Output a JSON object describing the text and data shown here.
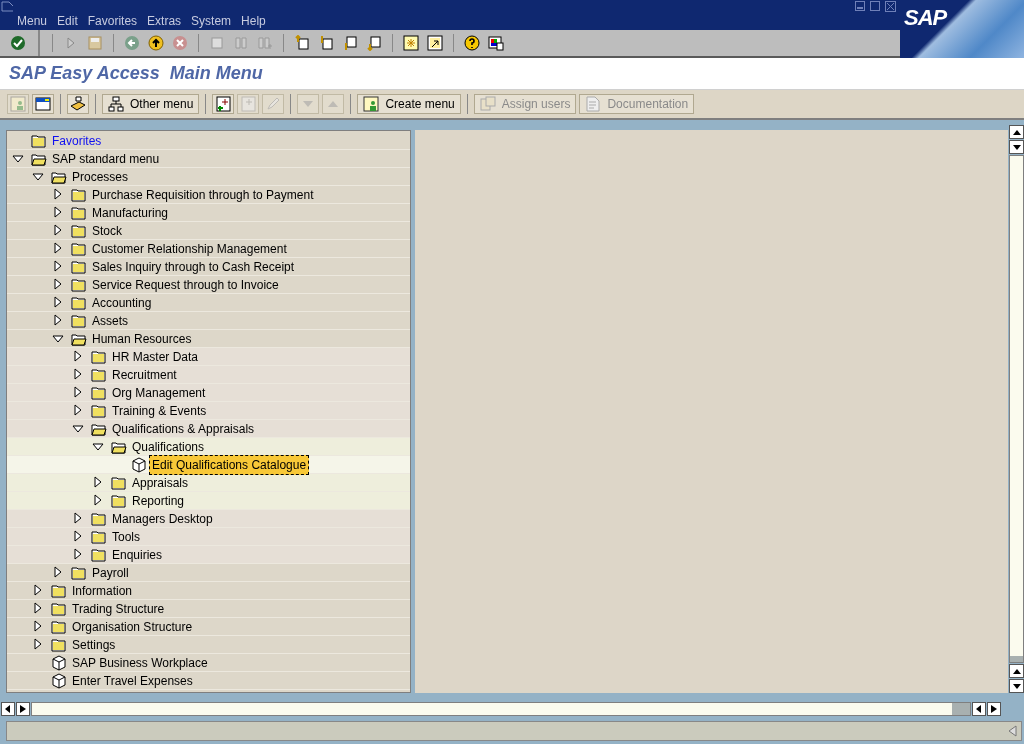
{
  "menu_bar": [
    "Menu",
    "Edit",
    "Favorites",
    "Extras",
    "System",
    "Help"
  ],
  "logo": "SAP",
  "title": "SAP Easy Access  Main Menu",
  "app_toolbar": [
    {
      "kind": "icon",
      "disabled": true
    },
    {
      "kind": "icon",
      "disabled": false
    },
    {
      "kind": "separator"
    },
    {
      "kind": "icon",
      "disabled": false
    },
    {
      "kind": "separator"
    },
    {
      "kind": "text",
      "label": "Other menu",
      "disabled": false
    },
    {
      "kind": "separator"
    },
    {
      "kind": "icon",
      "disabled": false
    },
    {
      "kind": "icon",
      "disabled": true
    },
    {
      "kind": "icon",
      "disabled": true
    },
    {
      "kind": "separator"
    },
    {
      "kind": "icon",
      "disabled": true
    },
    {
      "kind": "icon",
      "disabled": true
    },
    {
      "kind": "separator"
    },
    {
      "kind": "text",
      "label": "Create menu",
      "disabled": false
    },
    {
      "kind": "separator"
    },
    {
      "kind": "text",
      "label": "Assign users",
      "disabled": true
    },
    {
      "kind": "text",
      "label": "Documentation",
      "disabled": true
    }
  ],
  "tree": [
    {
      "label": "Favorites",
      "kind": "favorites",
      "expanded": false,
      "selected": false
    },
    {
      "label": "SAP standard menu",
      "kind": "folder",
      "expanded": true,
      "selected": false,
      "children": [
        {
          "label": "Processes",
          "kind": "folder",
          "expanded": true,
          "selected": false,
          "children": [
            {
              "label": "Purchase Requisition through to Payment",
              "kind": "folder",
              "expanded": false,
              "selected": false
            },
            {
              "label": "Manufacturing",
              "kind": "folder",
              "expanded": false,
              "selected": false
            },
            {
              "label": "Stock",
              "kind": "folder",
              "expanded": false,
              "selected": false
            },
            {
              "label": "Customer Relationship Management",
              "kind": "folder",
              "expanded": false,
              "selected": false
            },
            {
              "label": "Sales Inquiry through to Cash Receipt",
              "kind": "folder",
              "expanded": false,
              "selected": false
            },
            {
              "label": "Service Request through to Invoice",
              "kind": "folder",
              "expanded": false,
              "selected": false
            },
            {
              "label": "Accounting",
              "kind": "folder",
              "expanded": false,
              "selected": false
            },
            {
              "label": "Assets",
              "kind": "folder",
              "expanded": false,
              "selected": false
            },
            {
              "label": "Human Resources",
              "kind": "folder",
              "expanded": true,
              "selected": false,
              "children": [
                {
                  "label": "HR Master Data",
                  "kind": "folder",
                  "expanded": false,
                  "selected": false
                },
                {
                  "label": "Recruitment",
                  "kind": "folder",
                  "expanded": false,
                  "selected": false
                },
                {
                  "label": "Org Management",
                  "kind": "folder",
                  "expanded": false,
                  "selected": false
                },
                {
                  "label": "Training & Events",
                  "kind": "folder",
                  "expanded": false,
                  "selected": false
                },
                {
                  "label": "Qualifications & Appraisals",
                  "kind": "folder",
                  "expanded": true,
                  "selected": false,
                  "children": [
                    {
                      "label": "Qualifications",
                      "kind": "folder",
                      "expanded": true,
                      "selected": false,
                      "children": [
                        {
                          "label": "Edit Qualifications Catalogue",
                          "kind": "transaction",
                          "selected": true
                        }
                      ]
                    },
                    {
                      "label": "Appraisals",
                      "kind": "folder",
                      "expanded": false,
                      "selected": false
                    },
                    {
                      "label": "Reporting",
                      "kind": "folder",
                      "expanded": false,
                      "selected": false
                    }
                  ]
                },
                {
                  "label": "Managers Desktop",
                  "kind": "folder",
                  "expanded": false,
                  "selected": false
                },
                {
                  "label": "Tools",
                  "kind": "folder",
                  "expanded": false,
                  "selected": false
                },
                {
                  "label": "Enquiries",
                  "kind": "folder",
                  "expanded": false,
                  "selected": false
                }
              ]
            },
            {
              "label": "Payroll",
              "kind": "folder",
              "expanded": false,
              "selected": false
            }
          ]
        },
        {
          "label": "Information",
          "kind": "folder",
          "expanded": false,
          "selected": false
        },
        {
          "label": "Trading Structure",
          "kind": "folder",
          "expanded": false,
          "selected": false
        },
        {
          "label": "Organisation Structure",
          "kind": "folder",
          "expanded": false,
          "selected": false
        },
        {
          "label": "Settings",
          "kind": "folder",
          "expanded": false,
          "selected": false
        },
        {
          "label": "SAP Business Workplace",
          "kind": "transaction",
          "selected": false
        },
        {
          "label": "Enter Travel Expenses",
          "kind": "transaction",
          "selected": false
        }
      ]
    }
  ]
}
